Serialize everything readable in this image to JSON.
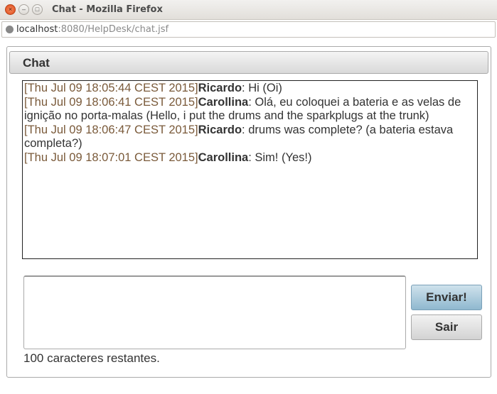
{
  "window": {
    "title": "Chat - Mozilla Firefox"
  },
  "urlbar": {
    "host": "localhost",
    "rest": ":8080/HelpDesk/chat.jsf"
  },
  "panel": {
    "title": "Chat"
  },
  "messages": [
    {
      "time": "[Thu Jul 09 18:05:44 CEST 2015]",
      "user": "Ricardo",
      "text": ": Hi (Oi)"
    },
    {
      "time": "[Thu Jul 09 18:06:41 CEST 2015]",
      "user": "Carollina",
      "text": ": Olá, eu coloquei a bateria e as velas de ignição no porta-malas (Hello, i put the drums and the sparkplugs at the trunk)"
    },
    {
      "time": "[Thu Jul 09 18:06:47 CEST 2015]",
      "user": "Ricardo",
      "text": ": drums was complete? (a bateria estava completa?)"
    },
    {
      "time": "[Thu Jul 09 18:07:01 CEST 2015]",
      "user": "Carollina",
      "text": ": Sim! (Yes!)"
    }
  ],
  "input": {
    "value": ""
  },
  "buttons": {
    "send": "Enviar!",
    "exit": "Sair"
  },
  "remaining": "100 caracteres restantes."
}
